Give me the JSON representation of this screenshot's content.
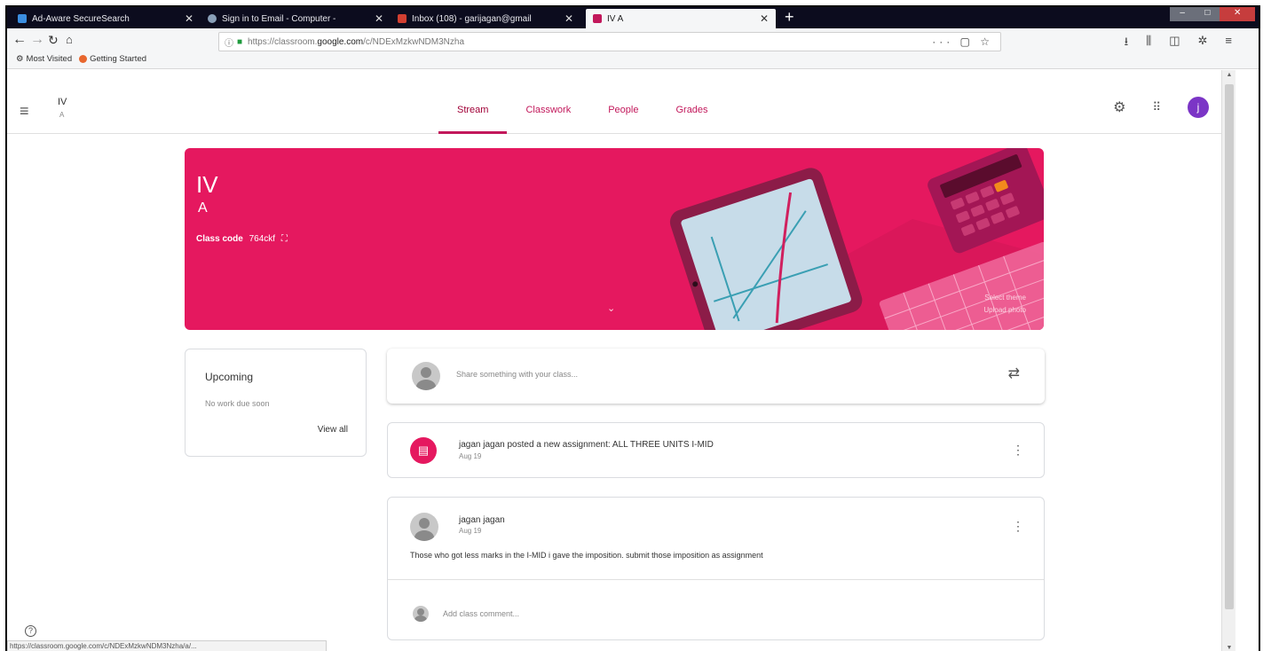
{
  "browser": {
    "tabs": [
      {
        "title": "Ad-Aware SecureSearch",
        "color": "#3b8ee0"
      },
      {
        "title": "Sign in to Email - Computer -",
        "color": "#8aa0b8"
      },
      {
        "title": "Inbox (108) - garijagan@gmail",
        "color": "#d23f31"
      },
      {
        "title": "IV A",
        "color": "#c2185b"
      }
    ],
    "url_prefix": "https://classroom.",
    "url_domain": "google.com",
    "url_path": "/c/NDExMzkwNDM3Nzha",
    "bookmarks": [
      "Most Visited",
      "Getting Started"
    ],
    "status_url": "https://classroom.google.com/c/NDExMzkwNDM3Nzha/a/..."
  },
  "header": {
    "class_name": "IV",
    "section": "A",
    "tabs": [
      "Stream",
      "Classwork",
      "People",
      "Grades"
    ],
    "avatar_letter": "j"
  },
  "banner": {
    "title": "IV",
    "section": "A",
    "class_code_label": "Class code",
    "class_code": "764ckf",
    "select_theme": "Select theme",
    "upload_photo": "Upload photo",
    "color": "#e5185f"
  },
  "upcoming": {
    "title": "Upcoming",
    "subtitle": "No work due soon",
    "view_all": "View all"
  },
  "share": {
    "placeholder": "Share something with your class..."
  },
  "posts": [
    {
      "text": "jagan jagan posted a new assignment: ALL THREE UNITS I-MID",
      "date": "Aug 19"
    },
    {
      "author": "jagan jagan",
      "date": "Aug 19",
      "body": "Those who got less marks in the I-MID i gave the imposition. submit those imposition as assignment",
      "comment_placeholder": "Add class comment..."
    }
  ]
}
